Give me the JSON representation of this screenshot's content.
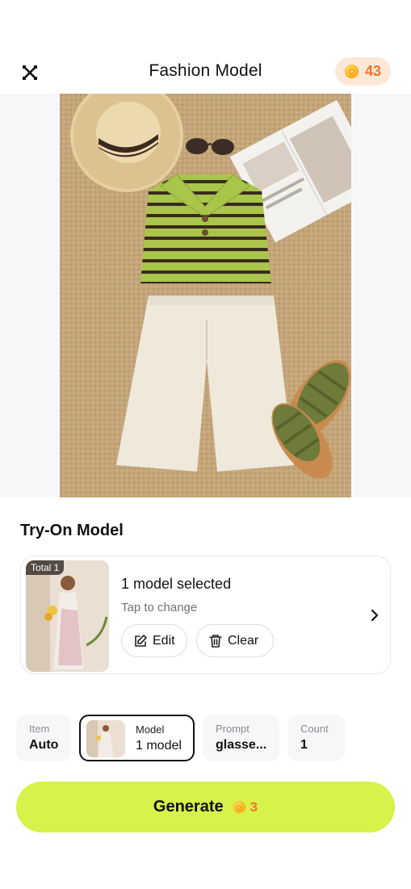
{
  "header": {
    "title": "Fashion Model",
    "credits": "43",
    "close_icon": "close-icon",
    "coin_icon": "coin-icon"
  },
  "product_image": {
    "description_icon": "product-flatlay-image"
  },
  "try_on": {
    "section_title": "Try-On Model",
    "badge": "Total 1",
    "selected_text": "1 model selected",
    "subtitle": "Tap to change",
    "edit_label": "Edit",
    "clear_label": "Clear"
  },
  "options": {
    "item": {
      "label": "Item",
      "value": "Auto"
    },
    "model": {
      "label": "Model",
      "value": "1 model"
    },
    "prompt": {
      "label": "Prompt",
      "value": "glasse..."
    },
    "count": {
      "label": "Count",
      "value": "1"
    }
  },
  "generate": {
    "label": "Generate",
    "cost": "3"
  },
  "colors": {
    "accent": "#d6f24b",
    "credits_bg": "#fde7d6",
    "credits_text": "#f1732c"
  }
}
